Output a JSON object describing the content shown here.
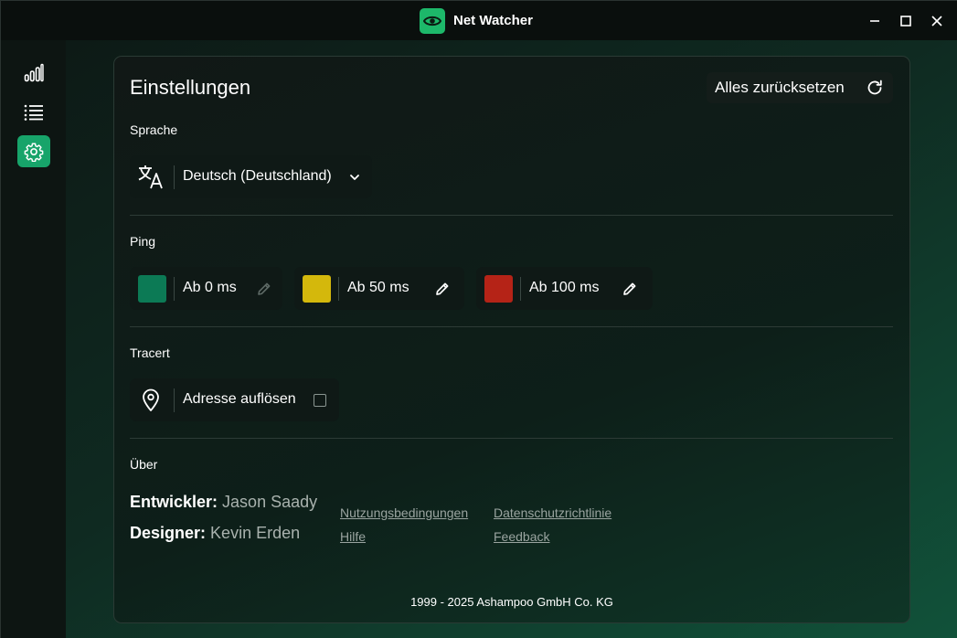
{
  "titlebar": {
    "title": "Net Watcher"
  },
  "sidebar": {
    "items": [
      {
        "name": "statistics",
        "icon": "signal-bars-icon"
      },
      {
        "name": "list",
        "icon": "list-icon"
      },
      {
        "name": "settings",
        "icon": "gear-icon",
        "active": true
      }
    ]
  },
  "settings": {
    "title": "Einstellungen",
    "reset_label": "Alles zurücksetzen",
    "language": {
      "section": "Sprache",
      "selected": "Deutsch (Deutschland)"
    },
    "ping": {
      "section": "Ping",
      "thresholds": [
        {
          "label": "Ab 0 ms",
          "color": "#0c7a55",
          "editable": false
        },
        {
          "label": "Ab 50 ms",
          "color": "#d4b80c",
          "editable": true
        },
        {
          "label": "Ab 100 ms",
          "color": "#b52317",
          "editable": true
        }
      ]
    },
    "tracert": {
      "section": "Tracert",
      "resolve_label": "Adresse auflösen",
      "resolve_checked": false
    },
    "about": {
      "section": "Über",
      "developer_role": "Entwickler:",
      "developer_name": "Jason Saady",
      "designer_role": "Designer:",
      "designer_name": "Kevin Erden",
      "links": {
        "terms": "Nutzungsbedingungen",
        "privacy": "Datenschutzrichtlinie",
        "help": "Hilfe",
        "feedback": "Feedback"
      }
    },
    "footer": "1999 - 2025 Ashampoo GmbH Co. KG"
  },
  "colors": {
    "accent": "#17a46a",
    "logo": "#1db86a"
  }
}
